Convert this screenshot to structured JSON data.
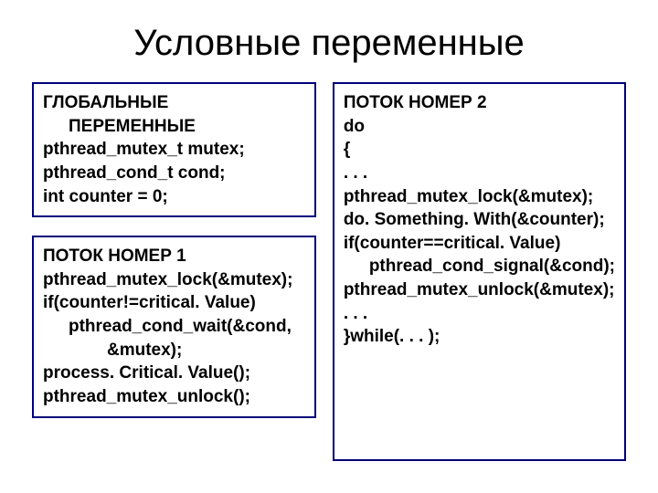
{
  "title": "Условные переменные",
  "left": {
    "globals_title": "ГЛОБАЛЬНЫЕ",
    "globals_title2": "ПЕРЕМЕННЫЕ",
    "g1": "pthread_mutex_t mutex;",
    "g2": "pthread_cond_t cond;",
    "g3": "int counter = 0;",
    "t1_title": "ПОТОК НОМЕР 1",
    "t1_l1": "pthread_mutex_lock(&mutex);",
    "t1_l2": "if(counter!=critical. Value)",
    "t1_l3": "pthread_cond_wait(&cond,",
    "t1_l4": "&mutex);",
    "t1_l5": "process. Critical. Value();",
    "t1_l6": "pthread_mutex_unlock();"
  },
  "right": {
    "t2_title": "ПОТОК НОМЕР 2",
    "l1": "do",
    "l2": "{",
    "l3": ". . .",
    "l4": "pthread_mutex_lock(&mutex);",
    "l5": "do. Something. With(&counter);",
    "l6": "if(counter==critical. Value)",
    "l7": "pthread_cond_signal(&cond);",
    "l8": "pthread_mutex_unlock(&mutex);",
    "l9": ". . .",
    "l10": "}while(. . . );"
  }
}
